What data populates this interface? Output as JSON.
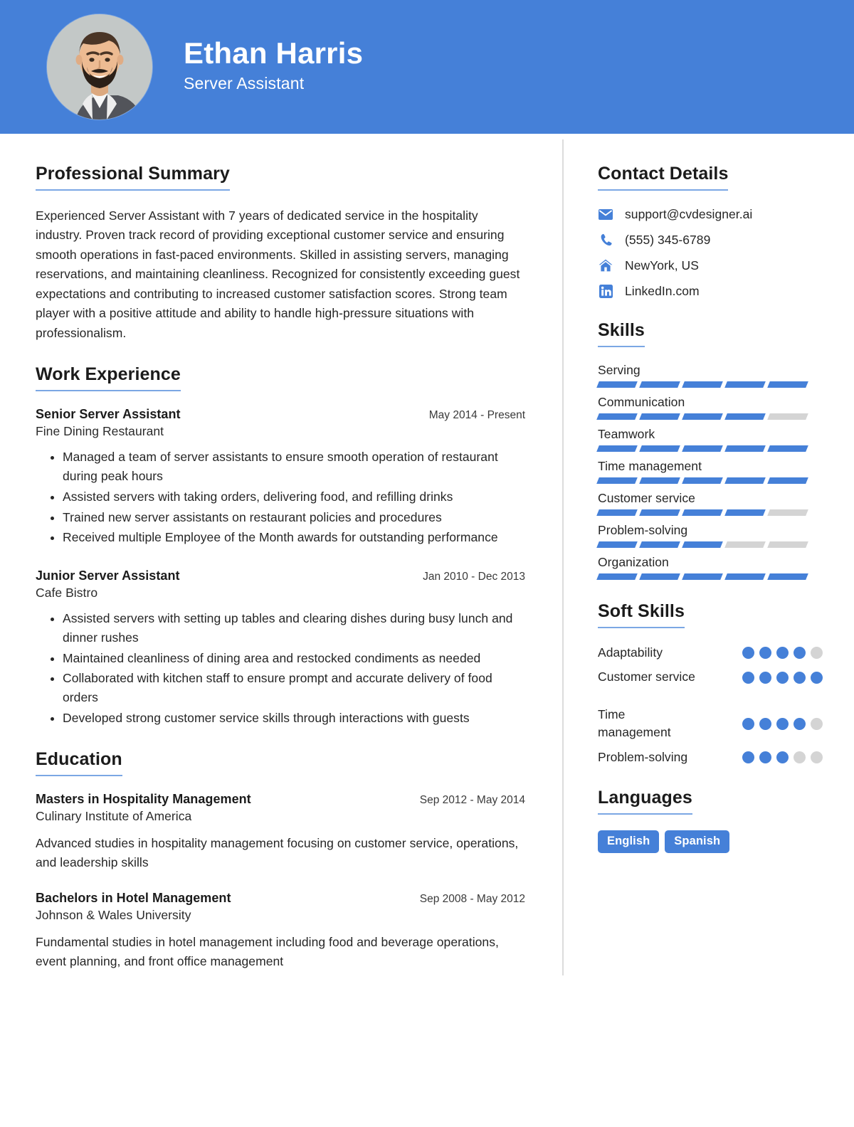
{
  "theme": {
    "accent": "#4580d8",
    "rule": "#7ba7e4",
    "muted_segment": "#d4d4d4",
    "text": "#262626"
  },
  "header": {
    "name": "Ethan Harris",
    "role": "Server Assistant",
    "avatar_alt": "profile-photo"
  },
  "left": {
    "summary_heading": "Professional Summary",
    "summary_text": "Experienced Server Assistant with 7 years of dedicated service in the hospitality industry. Proven track record of providing exceptional customer service and ensuring smooth operations in fast-paced environments. Skilled in assisting servers, managing reservations, and maintaining cleanliness. Recognized for consistently exceeding guest expectations and contributing to increased customer satisfaction scores. Strong team player with a positive attitude and ability to handle high-pressure situations with professionalism.",
    "experience_heading": "Work Experience",
    "experience": [
      {
        "title": "Senior Server Assistant",
        "company": "Fine Dining Restaurant",
        "date": "May 2014 - Present",
        "bullets": [
          "Managed a team of server assistants to ensure smooth operation of restaurant during peak hours",
          "Assisted servers with taking orders, delivering food, and refilling drinks",
          "Trained new server assistants on restaurant policies and procedures",
          "Received multiple Employee of the Month awards for outstanding performance"
        ]
      },
      {
        "title": "Junior Server Assistant",
        "company": "Cafe Bistro",
        "date": "Jan 2010 - Dec 2013",
        "bullets": [
          "Assisted servers with setting up tables and clearing dishes during busy lunch and dinner rushes",
          "Maintained cleanliness of dining area and restocked condiments as needed",
          "Collaborated with kitchen staff to ensure prompt and accurate delivery of food orders",
          "Developed strong customer service skills through interactions with guests"
        ]
      }
    ],
    "education_heading": "Education",
    "education": [
      {
        "degree": "Masters in Hospitality Management",
        "school": "Culinary Institute of America",
        "date": "Sep 2012 - May 2014",
        "description": "Advanced studies in hospitality management focusing on customer service, operations, and leadership skills"
      },
      {
        "degree": "Bachelors in Hotel Management",
        "school": "Johnson & Wales University",
        "date": "Sep 2008 - May 2012",
        "description": "Fundamental studies in hotel management including food and beverage operations, event planning, and front office management"
      }
    ]
  },
  "right": {
    "contact_heading": "Contact Details",
    "contact": [
      {
        "icon": "envelope-icon",
        "value": "support@cvdesigner.ai"
      },
      {
        "icon": "phone-icon",
        "value": "(555) 345-6789"
      },
      {
        "icon": "home-icon",
        "value": "NewYork, US"
      },
      {
        "icon": "linkedin-icon",
        "value": "LinkedIn.com"
      }
    ],
    "skills_heading": "Skills",
    "skills": [
      {
        "name": "Serving",
        "level": 5,
        "max": 5
      },
      {
        "name": "Communication",
        "level": 4,
        "max": 5
      },
      {
        "name": "Teamwork",
        "level": 5,
        "max": 5
      },
      {
        "name": "Time management",
        "level": 5,
        "max": 5
      },
      {
        "name": "Customer service",
        "level": 4,
        "max": 5
      },
      {
        "name": "Problem-solving",
        "level": 3,
        "max": 5
      },
      {
        "name": "Organization",
        "level": 5,
        "max": 5
      }
    ],
    "soft_skills_heading": "Soft Skills",
    "soft_skills": [
      {
        "name": "Adaptability",
        "level": 4,
        "max": 5
      },
      {
        "name": "Customer service",
        "level": 5,
        "max": 5
      },
      {
        "name": "Time management",
        "level": 4,
        "max": 5
      },
      {
        "name": "Problem-solving",
        "level": 3,
        "max": 5
      }
    ],
    "languages_heading": "Languages",
    "languages": [
      "English",
      "Spanish"
    ]
  }
}
